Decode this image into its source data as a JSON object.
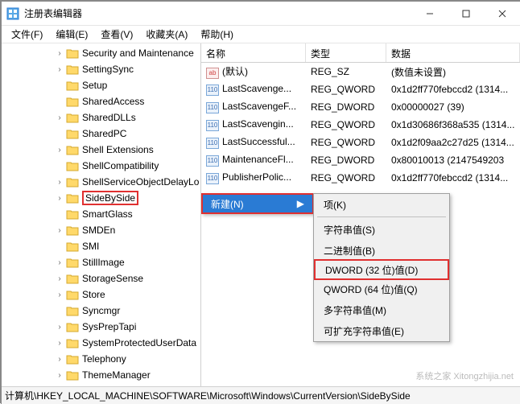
{
  "window": {
    "title": "注册表编辑器"
  },
  "menu": {
    "file": "文件(F)",
    "edit": "编辑(E)",
    "view": "查看(V)",
    "favorites": "收藏夹(A)",
    "help": "帮助(H)"
  },
  "tree": {
    "items": [
      {
        "depth": 3,
        "exp": "›",
        "label": "Security and Maintenance"
      },
      {
        "depth": 3,
        "exp": "›",
        "label": "SettingSync"
      },
      {
        "depth": 3,
        "exp": "",
        "label": "Setup"
      },
      {
        "depth": 3,
        "exp": "",
        "label": "SharedAccess"
      },
      {
        "depth": 3,
        "exp": "›",
        "label": "SharedDLLs"
      },
      {
        "depth": 3,
        "exp": "",
        "label": "SharedPC"
      },
      {
        "depth": 3,
        "exp": "›",
        "label": "Shell Extensions"
      },
      {
        "depth": 3,
        "exp": "",
        "label": "ShellCompatibility"
      },
      {
        "depth": 3,
        "exp": "›",
        "label": "ShellServiceObjectDelayLo"
      },
      {
        "depth": 3,
        "exp": "›",
        "label": "SideBySide",
        "highlight": true
      },
      {
        "depth": 3,
        "exp": "",
        "label": "SmartGlass"
      },
      {
        "depth": 3,
        "exp": "›",
        "label": "SMDEn"
      },
      {
        "depth": 3,
        "exp": "",
        "label": "SMI"
      },
      {
        "depth": 3,
        "exp": "›",
        "label": "StillImage"
      },
      {
        "depth": 3,
        "exp": "›",
        "label": "StorageSense"
      },
      {
        "depth": 3,
        "exp": "›",
        "label": "Store"
      },
      {
        "depth": 3,
        "exp": "",
        "label": "Syncmgr"
      },
      {
        "depth": 3,
        "exp": "›",
        "label": "SysPrepTapi"
      },
      {
        "depth": 3,
        "exp": "›",
        "label": "SystemProtectedUserData"
      },
      {
        "depth": 3,
        "exp": "›",
        "label": "Telephony"
      },
      {
        "depth": 3,
        "exp": "›",
        "label": "ThemeManager"
      }
    ]
  },
  "columns": {
    "name": "名称",
    "type": "类型",
    "data": "数据"
  },
  "values": [
    {
      "icon": "str",
      "name": "(默认)",
      "type": "REG_SZ",
      "data": "(数值未设置)"
    },
    {
      "icon": "bin",
      "name": "LastScavenge...",
      "type": "REG_QWORD",
      "data": "0x1d2ff770febccd2 (1314..."
    },
    {
      "icon": "bin",
      "name": "LastScavengeF...",
      "type": "REG_DWORD",
      "data": "0x00000027 (39)"
    },
    {
      "icon": "bin",
      "name": "LastScavengin...",
      "type": "REG_QWORD",
      "data": "0x1d30686f368a535 (1314..."
    },
    {
      "icon": "bin",
      "name": "LastSuccessful...",
      "type": "REG_QWORD",
      "data": "0x1d2f09aa2c27d25 (1314..."
    },
    {
      "icon": "bin",
      "name": "MaintenanceFl...",
      "type": "REG_DWORD",
      "data": "0x80010013 (2147549203"
    },
    {
      "icon": "bin",
      "name": "PublisherPolic...",
      "type": "REG_QWORD",
      "data": "0x1d2ff770febccd2 (1314..."
    }
  ],
  "context1": {
    "new": "新建(N)",
    "arrow": "▶"
  },
  "context2": {
    "key": "项(K)",
    "string": "字符串值(S)",
    "binary": "二进制值(B)",
    "dword": "DWORD (32 位)值(D)",
    "qword": "QWORD (64 位)值(Q)",
    "multi": "多字符串值(M)",
    "expand": "可扩充字符串值(E)"
  },
  "status": {
    "path": "计算机\\HKEY_LOCAL_MACHINE\\SOFTWARE\\Microsoft\\Windows\\CurrentVersion\\SideBySide"
  },
  "watermark": "系统之家 Xitongzhijia.net"
}
